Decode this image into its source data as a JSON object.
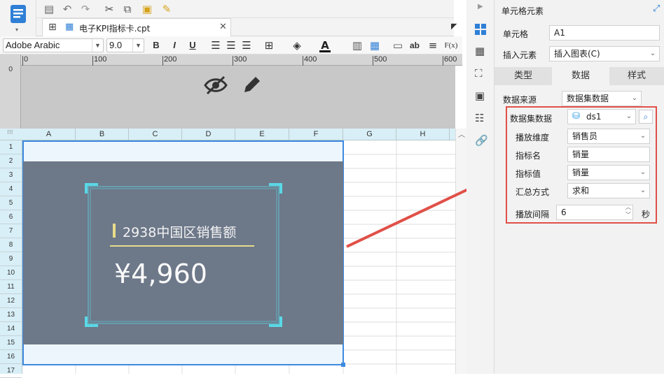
{
  "toolbar": {
    "icons": [
      "save-icon",
      "undo-icon",
      "redo-icon",
      "cut-icon",
      "copy-icon",
      "paste-icon",
      "format-painter-icon"
    ]
  },
  "document_tab": {
    "title": "电子KPI指标卡.cpt"
  },
  "format_bar": {
    "font_family": "Adobe Arabic",
    "font_size": "9.0",
    "bold": "B",
    "italic": "I",
    "underline": "U",
    "fx": "F(x)",
    "ab": "ab"
  },
  "ruler": {
    "marks": [
      "0",
      "100",
      "200",
      "300",
      "400",
      "500",
      "600"
    ],
    "vertical_mark": "0"
  },
  "grid": {
    "columns": [
      "A",
      "B",
      "C",
      "D",
      "E",
      "F",
      "G",
      "H"
    ],
    "rows": [
      "1",
      "2",
      "3",
      "4",
      "5",
      "6",
      "7",
      "8",
      "9",
      "10",
      "11",
      "12",
      "13",
      "14",
      "15",
      "16",
      "17"
    ]
  },
  "kpi_card": {
    "title": "2938中国区销售额",
    "value": "¥4,960",
    "accent_color": "#5ad8e6",
    "bar_color": "#e8dc8a",
    "background": "#6d7889"
  },
  "panel": {
    "header": "单元格元素",
    "cell_label": "单元格",
    "cell_value": "A1",
    "insert_label": "插入元素",
    "insert_value": "插入图表(C)",
    "tabs": [
      "类型",
      "数据",
      "样式"
    ],
    "active_tab": "数据",
    "source_label": "数据来源",
    "source_value": "数据集数据",
    "dataset_label": "数据集数据",
    "dataset_value": "ds1",
    "dimension_label": "播放维度",
    "dimension_value": "销售员",
    "metric_name_label": "指标名",
    "metric_name_value": "销量",
    "metric_value_label": "指标值",
    "metric_value_value": "销量",
    "agg_label": "汇总方式",
    "agg_value": "求和",
    "interval_label": "播放间隔",
    "interval_value": "6",
    "interval_unit": "秒",
    "highlight_color": "#e05048"
  }
}
